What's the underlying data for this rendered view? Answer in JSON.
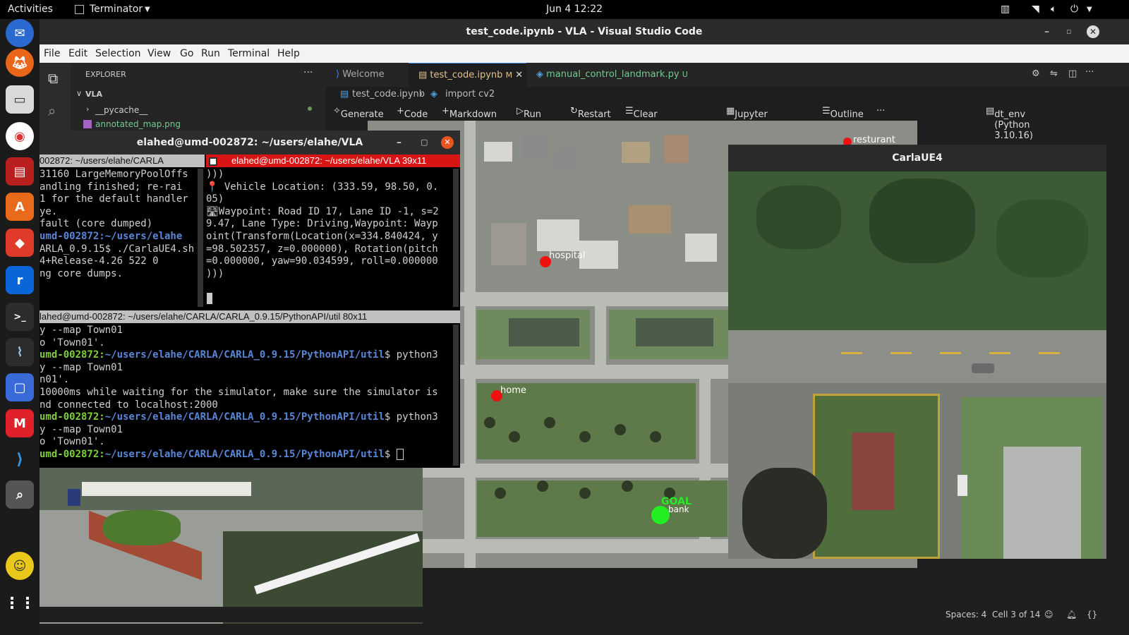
{
  "topbar": {
    "activities": "Activities",
    "app": "Terminator",
    "datetime": "Jun 4  12:22"
  },
  "vscode": {
    "title": "test_code.ipynb - VLA - Visual Studio Code",
    "menu": [
      "File",
      "Edit",
      "Selection",
      "View",
      "Go",
      "Run",
      "Terminal",
      "Help"
    ],
    "explorer": {
      "header": "EXPLORER",
      "root": "VLA",
      "items": [
        "__pycache__",
        "annotated_map.png"
      ]
    },
    "tabs": [
      {
        "label": "Welcome"
      },
      {
        "label": "test_code.ipynb",
        "badge": "M"
      },
      {
        "label": "manual_control_landmark.py",
        "badge": "U"
      }
    ],
    "breadcrumb": [
      "test_code.ipynb",
      "import cv2"
    ],
    "toolbar": {
      "generate": "Generate",
      "code": "Code",
      "markdown": "Markdown",
      "run_all": "Run All",
      "restart": "Restart",
      "clear": "Clear All Outputs",
      "jupyter": "Jupyter Variables",
      "outline": "Outline",
      "more": "···",
      "kernel": "dt_env (Python 3.10.16)"
    },
    "status": {
      "spaces": "Spaces: 4",
      "cell": "Cell 3 of 14"
    }
  },
  "map": {
    "labels": [
      "resturant",
      "hospital",
      "home",
      "GOAL",
      "bank"
    ]
  },
  "carla": {
    "title": "CarlaUE4"
  },
  "terminator": {
    "title": "elahed@umd-002872: ~/users/elahe/VLA",
    "pane_left": {
      "title": "002872: ~/users/elahe/CARLA",
      "lines": [
        "31160 LargeMemoryPoolOffs",
        "",
        "andling finished; re-rai",
        "1 for the default handler",
        "ye.",
        "fault (core dumped)",
        "umd-002872:~/users/elahe",
        "ARLA_0.9.15$ ./CarlaUE4.sh",
        "4+Release-4.26 522 0",
        "ng core dumps."
      ]
    },
    "pane_right": {
      "title": "elahed@umd-002872: ~/users/elahe/VLA 39x11",
      "lines": [
        ")))",
        "",
        "📍 Vehicle Location: (333.59, 98.50, 0.",
        "05)",
        "🛣Waypoint: Road ID 17, Lane ID -1, s=2",
        "9.47, Lane Type: Driving,Waypoint: Wayp",
        "oint(Transform(Location(x=334.840424, y",
        "=98.502357, z=0.000000), Rotation(pitch",
        "=0.000000, yaw=90.034599, roll=0.000000",
        ")))"
      ]
    },
    "pane_bottom": {
      "title": "lahed@umd-002872: ~/users/elahe/CARLA/CARLA_0.9.15/PythonAPI/util 80x11",
      "lines": [
        {
          "pre": "y --map Town01",
          "host": "",
          "path": "",
          "cmd": ""
        },
        {
          "pre": "o 'Town01'.",
          "host": "",
          "path": "",
          "cmd": ""
        },
        {
          "pre": "",
          "host": "umd-002872:",
          "path": "~/users/elahe/CARLA/CARLA_0.9.15/PythonAPI/util",
          "cmd": "$ python3"
        },
        {
          "pre": "y --map Town01",
          "host": "",
          "path": "",
          "cmd": ""
        },
        {
          "pre": "n01'.",
          "host": "",
          "path": "",
          "cmd": ""
        },
        {
          "pre": "10000ms while waiting for the simulator, make sure the simulator is",
          "host": "",
          "path": "",
          "cmd": ""
        },
        {
          "pre": "nd connected to localhost:2000",
          "host": "",
          "path": "",
          "cmd": ""
        },
        {
          "pre": "",
          "host": "umd-002872:",
          "path": "~/users/elahe/CARLA/CARLA_0.9.15/PythonAPI/util",
          "cmd": "$ python3"
        },
        {
          "pre": "y --map Town01",
          "host": "",
          "path": "",
          "cmd": ""
        },
        {
          "pre": "o 'Town01'.",
          "host": "",
          "path": "",
          "cmd": ""
        },
        {
          "pre": "",
          "host": "umd-002872:",
          "path": "~/users/elahe/CARLA/CARLA_0.9.15/PythonAPI/util",
          "cmd": "$ "
        }
      ]
    }
  }
}
